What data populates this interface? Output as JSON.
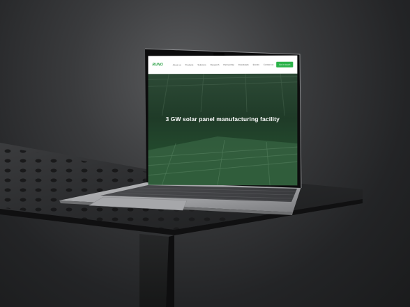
{
  "site": {
    "logo": "RUNO",
    "nav_items": [
      "About us",
      "Products",
      "Solutions",
      "Research",
      "Partnership",
      "Downloads",
      "Events",
      "Contact us"
    ],
    "cta_label": "Get in touch"
  },
  "hero": {
    "title": "3 GW solar panel manufacturing facility"
  },
  "colors": {
    "brand_green": "#2cb34a",
    "hero_overlay": "#1f3b28"
  }
}
